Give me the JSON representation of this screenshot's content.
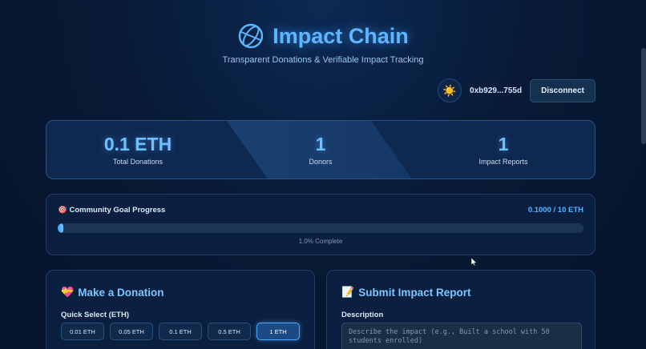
{
  "header": {
    "title": "Impact Chain",
    "subtitle": "Transparent Donations & Verifiable Impact Tracking",
    "logo_icon": "globe-icon"
  },
  "wallet": {
    "theme_icon": "☀️",
    "address": "0xb929...755d",
    "disconnect_label": "Disconnect"
  },
  "stats": [
    {
      "value": "0.1 ETH",
      "label": "Total Donations"
    },
    {
      "value": "1",
      "label": "Donors"
    },
    {
      "value": "1",
      "label": "Impact Reports"
    }
  ],
  "goal": {
    "icon": "🎯",
    "title": "Community Goal Progress",
    "amount": "0.1000 / 10 ETH",
    "percent": 1.0,
    "progress_text": "1.0% Complete"
  },
  "donate": {
    "icon": "💝",
    "title": "Make a Donation",
    "quick_label": "Quick Select (ETH)",
    "quick_options": [
      "0.01 ETH",
      "0.05 ETH",
      "0.1 ETH",
      "0.5 ETH",
      "1 ETH"
    ],
    "selected": "1 ETH"
  },
  "report": {
    "icon": "📝",
    "title": "Submit Impact Report",
    "description_label": "Description",
    "description_placeholder": "Describe the impact (e.g., Built a school with 50 students enrolled)",
    "description_value": ""
  },
  "colors": {
    "accent": "#5fb6ff",
    "background": "#081a36"
  }
}
